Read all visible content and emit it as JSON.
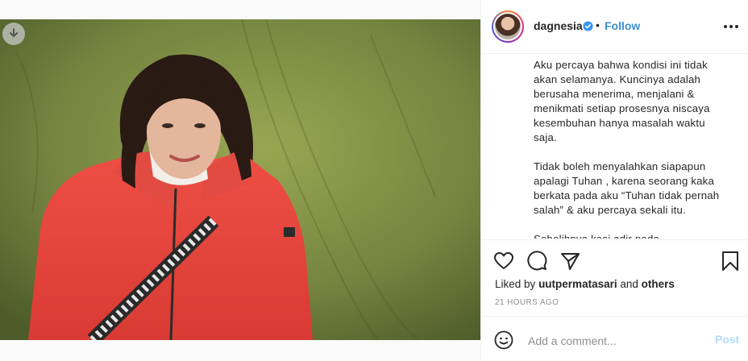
{
  "post": {
    "username": "dagnesia",
    "separator": "•",
    "follow_label": "Follow",
    "caption": {
      "paragraph_1": "Aku percaya bahwa kondisi ini tidak akan selamanya. Kuncinya adalah berusaha menerima, menjalani & menikmati setiap prosesnya niscaya kesembuhan hanya masalah waktu saja.",
      "paragraph_2": "Tidak boleh menyalahkan siapapun apalagi Tuhan , karena seorang kaka berkata pada aku “Tuhan tidak pernah salah” & aku percaya sekali itu.",
      "paragraph_3": "Sebelihnya kasi adir pada..."
    },
    "likes": {
      "prefix": "Liked by",
      "first_user": "uutpermatasari",
      "connector": "and",
      "others": "others"
    },
    "timestamp": "21 HOURS AGO",
    "comment": {
      "placeholder": "Add a comment...",
      "post_label": "Post"
    }
  },
  "icons": {
    "download": "download-arrow-icon",
    "verified": "verified-badge-icon",
    "more": "more-options-icon",
    "like": "heart-icon",
    "comment": "comment-bubble-icon",
    "share": "paper-plane-icon",
    "save": "bookmark-icon",
    "emoji": "emoji-smile-icon"
  },
  "colors": {
    "accent": "#3a8fd0",
    "post_disabled": "#b3dbff",
    "jacket": "#e8443d",
    "meta_gray": "#8e8e8e"
  }
}
